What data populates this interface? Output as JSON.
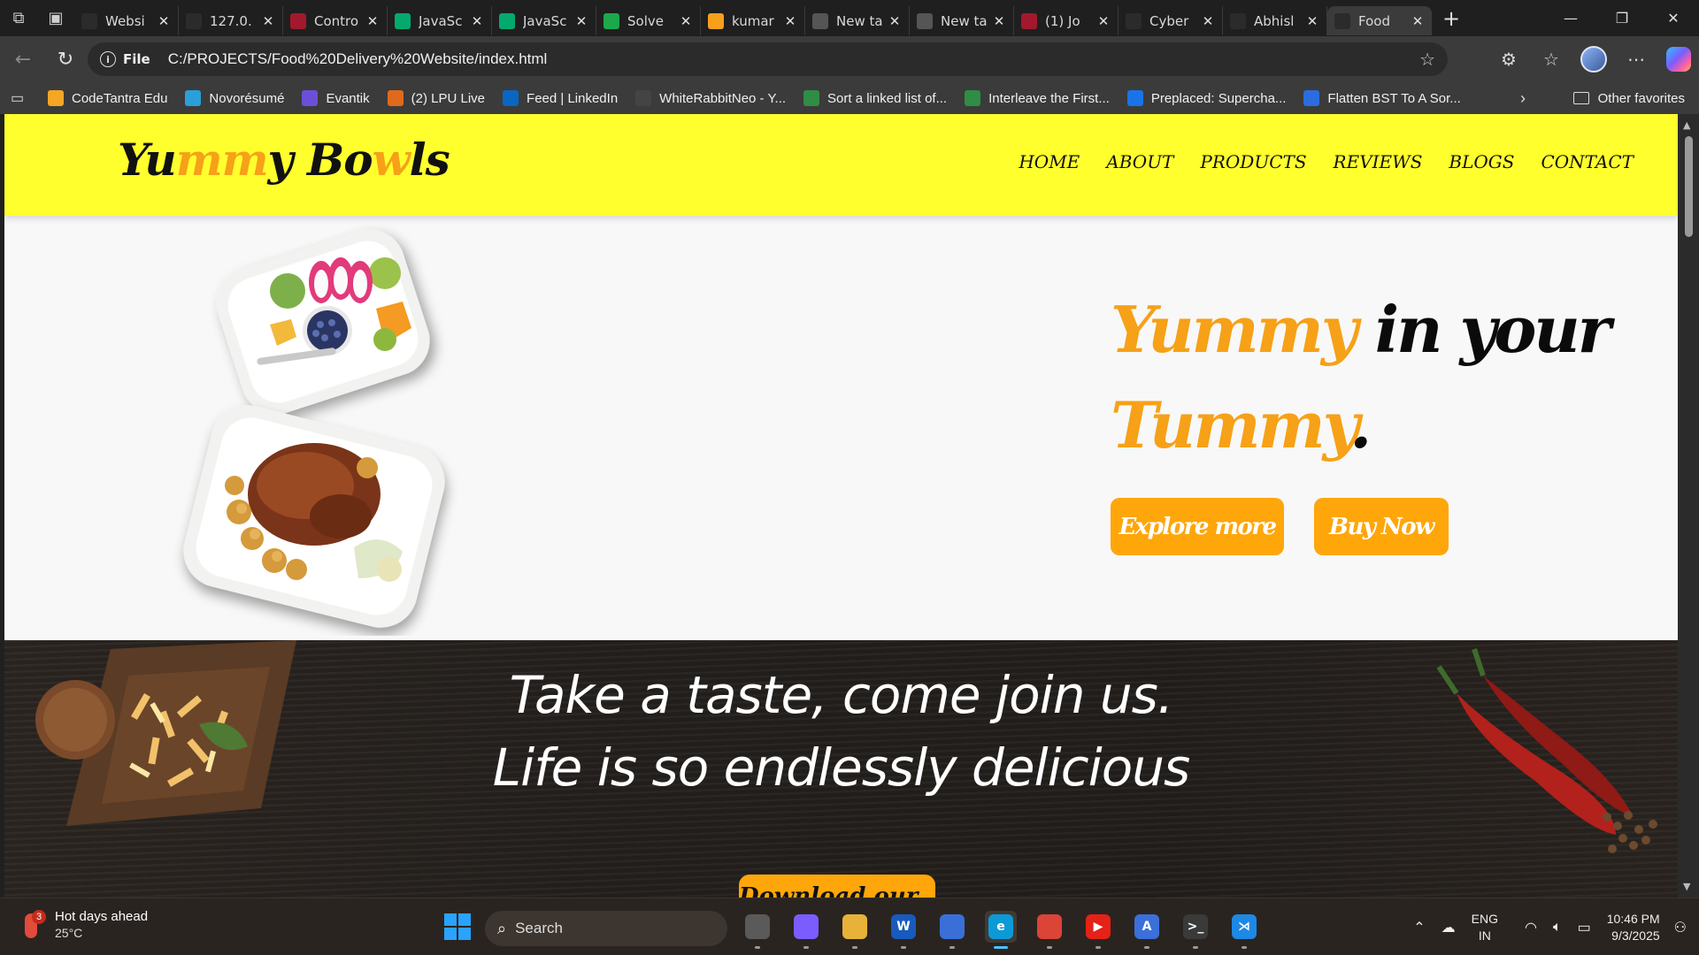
{
  "browser": {
    "tabs": [
      {
        "title": "Websi",
        "icon": "github-icon",
        "color": "#2b2b2b"
      },
      {
        "title": "127.0.",
        "icon": "page-refresh-icon",
        "color": "#2b2b2b"
      },
      {
        "title": "Contro",
        "icon": "youtube-icon",
        "color": "#a3192c"
      },
      {
        "title": "JavaSc",
        "icon": "w3schools-icon",
        "color": "#04aa6d"
      },
      {
        "title": "JavaSc",
        "icon": "w3schools-icon",
        "color": "#04aa6d"
      },
      {
        "title": "Solve",
        "icon": "hackerrank-icon",
        "color": "#1ba94c"
      },
      {
        "title": "kumar",
        "icon": "leetcode-icon",
        "color": "#f89f1b"
      },
      {
        "title": "New ta",
        "icon": "new-tab-icon",
        "color": "#555555"
      },
      {
        "title": "New ta",
        "icon": "new-tab-icon",
        "color": "#555555"
      },
      {
        "title": "(1) Jo",
        "icon": "youtube-icon",
        "color": "#a3192c"
      },
      {
        "title": "Cyber",
        "icon": "chatgpt-icon",
        "color": "#2b2b2b"
      },
      {
        "title": "Abhisl",
        "icon": "globe-icon",
        "color": "#2b2b2b"
      },
      {
        "title": "Food",
        "icon": "globe-icon",
        "color": "#2b2b2b",
        "active": true
      }
    ],
    "address": {
      "scheme": "File",
      "url": "C:/PROJECTS/Food%20Delivery%20Website/index.html"
    },
    "favorites": [
      {
        "label": "CodeTantra Edu",
        "color": "#f5a623"
      },
      {
        "label": "Novorésumé",
        "color": "#2aa0d8"
      },
      {
        "label": "Evantik",
        "color": "#6b4fd8"
      },
      {
        "label": "(2) LPU Live",
        "color": "#e06a1b"
      },
      {
        "label": "Feed | LinkedIn",
        "color": "#0a66c2"
      },
      {
        "label": "WhiteRabbitNeo - Y...",
        "color": "#444444"
      },
      {
        "label": "Sort a linked list of...",
        "color": "#2f8d46"
      },
      {
        "label": "Interleave the First...",
        "color": "#2f8d46"
      },
      {
        "label": "Preplaced: Supercha...",
        "color": "#1a73e8"
      },
      {
        "label": "Flatten BST To A Sor...",
        "color": "#2d6cdf"
      }
    ],
    "other_favorites": "Other favorites"
  },
  "site": {
    "logo": {
      "part1": "Yu",
      "part2": "mm",
      "part3": "y Bo",
      "part4": "w",
      "part5": "ls"
    },
    "nav": [
      "HOME",
      "ABOUT",
      "PRODUCTS",
      "REVIEWS",
      "BLOGS",
      "CONTACT"
    ],
    "hero": {
      "word1": "Yummy",
      "word2": "in your",
      "word3": "Tummy",
      "word4": ".",
      "explore_label": "Explore more",
      "buy_label": "Buy Now"
    },
    "band": {
      "line1": "Take a taste, come join us.",
      "line2": "Life is so endlessly delicious",
      "download_label": "Download our app"
    },
    "accent": "#f6a117",
    "header_color": "#ffff2e",
    "button_color": "#ffa60a"
  },
  "taskbar": {
    "weather": {
      "title": "Hot days ahead",
      "temp": "25°C",
      "badge": "3"
    },
    "search_placeholder": "Search",
    "apps": [
      {
        "name": "task-view-icon",
        "color": "#5a5a5a",
        "glyph": ""
      },
      {
        "name": "copilot-icon",
        "color": "#7a5cff",
        "glyph": ""
      },
      {
        "name": "file-explorer-icon",
        "color": "#e8b23a",
        "glyph": ""
      },
      {
        "name": "word-icon",
        "color": "#185abd",
        "glyph": "W"
      },
      {
        "name": "microsoft-store-icon",
        "color": "#3a6fd8",
        "glyph": ""
      },
      {
        "name": "edge-icon",
        "color": "#0c9ad6",
        "glyph": "e",
        "active": true
      },
      {
        "name": "chrome-icon",
        "color": "#db4437",
        "glyph": ""
      },
      {
        "name": "youtube-icon",
        "color": "#e62117",
        "glyph": "▶"
      },
      {
        "name": "app-icon",
        "color": "#3b6fd9",
        "glyph": "A"
      },
      {
        "name": "terminal-icon",
        "color": "#3a3a3a",
        "glyph": ">_"
      },
      {
        "name": "vscode-icon",
        "color": "#1e88e5",
        "glyph": "⋊"
      }
    ],
    "lang": {
      "line1": "ENG",
      "line2": "IN"
    },
    "clock": {
      "time": "10:46 PM",
      "date": "9/3/2025"
    }
  }
}
